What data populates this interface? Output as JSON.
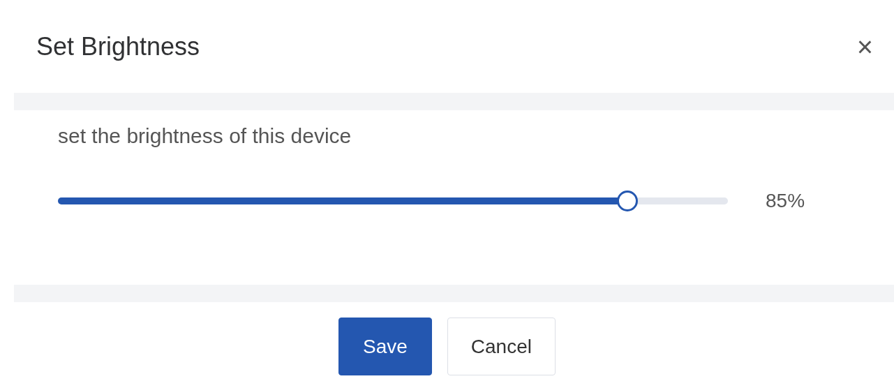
{
  "dialog": {
    "title": "Set Brightness",
    "close": "×"
  },
  "body": {
    "description": "set the brightness of this device",
    "slider": {
      "level": 0.85,
      "reading": "85%"
    }
  },
  "buttons": [
    {
      "label": "Save",
      "kind": "primary"
    },
    {
      "label": "Cancel",
      "kind": "secondary"
    }
  ]
}
